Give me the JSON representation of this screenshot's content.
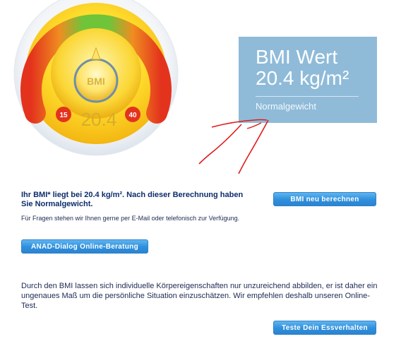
{
  "gauge": {
    "badge_label": "BMI",
    "min_label": "15",
    "max_label": "40",
    "value_text": "20.4"
  },
  "result_card": {
    "title": "BMI Wert",
    "value": "20.4 kg/m²",
    "category": "Normalgewicht",
    "background_color": "#8fbbd9"
  },
  "result": {
    "text": "Ihr BMI* liegt bei 20.4 kg/m². Nach dieser Berechnung haben Sie Normalgewicht.",
    "contact": "Für Fragen stehen wir Ihnen gerne per E-Mail oder telefonisch zur Verfügung."
  },
  "buttons": {
    "recalculate": "BMI neu berechnen",
    "dialog": "ANAD-Dialog Online-Beratung",
    "test": "Teste Dein Essverhalten"
  },
  "info": {
    "text": "Durch den BMI lassen sich individuelle Körpereigenschaften nur unzureichend abbilden, er ist daher ein ungenaues Maß um die persönliche Situation einzuschätzen. Wir empfehlen deshalb unseren Online-Test."
  },
  "colors": {
    "button_blue": "#2f8fdc",
    "annotation_red": "#e01a1a",
    "text_dark_blue": "#0c2d6b"
  }
}
